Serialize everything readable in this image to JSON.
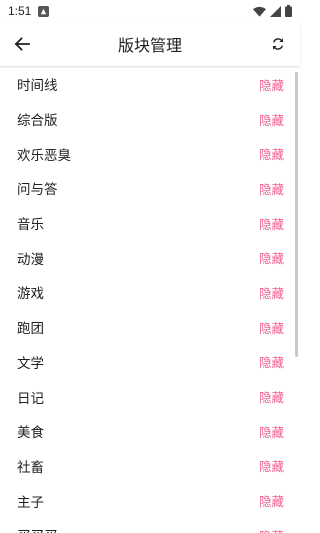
{
  "status": {
    "time": "1:51"
  },
  "header": {
    "title": "版块管理",
    "back_icon": "arrow-left-icon",
    "refresh_icon": "refresh-icon"
  },
  "boards": [
    {
      "name": "时间线",
      "action": "隐藏"
    },
    {
      "name": "综合版",
      "action": "隐藏"
    },
    {
      "name": "欢乐恶臭",
      "action": "隐藏"
    },
    {
      "name": "问与答",
      "action": "隐藏"
    },
    {
      "name": "音乐",
      "action": "隐藏"
    },
    {
      "name": "动漫",
      "action": "隐藏"
    },
    {
      "name": "游戏",
      "action": "隐藏"
    },
    {
      "name": "跑团",
      "action": "隐藏"
    },
    {
      "name": "文学",
      "action": "隐藏"
    },
    {
      "name": "日记",
      "action": "隐藏"
    },
    {
      "name": "美食",
      "action": "隐藏"
    },
    {
      "name": "社畜",
      "action": "隐藏"
    },
    {
      "name": "主子",
      "action": "隐藏"
    },
    {
      "name": "买买买",
      "action": "隐藏"
    }
  ],
  "colors": {
    "accent": "#f06292",
    "text": "#212121"
  }
}
